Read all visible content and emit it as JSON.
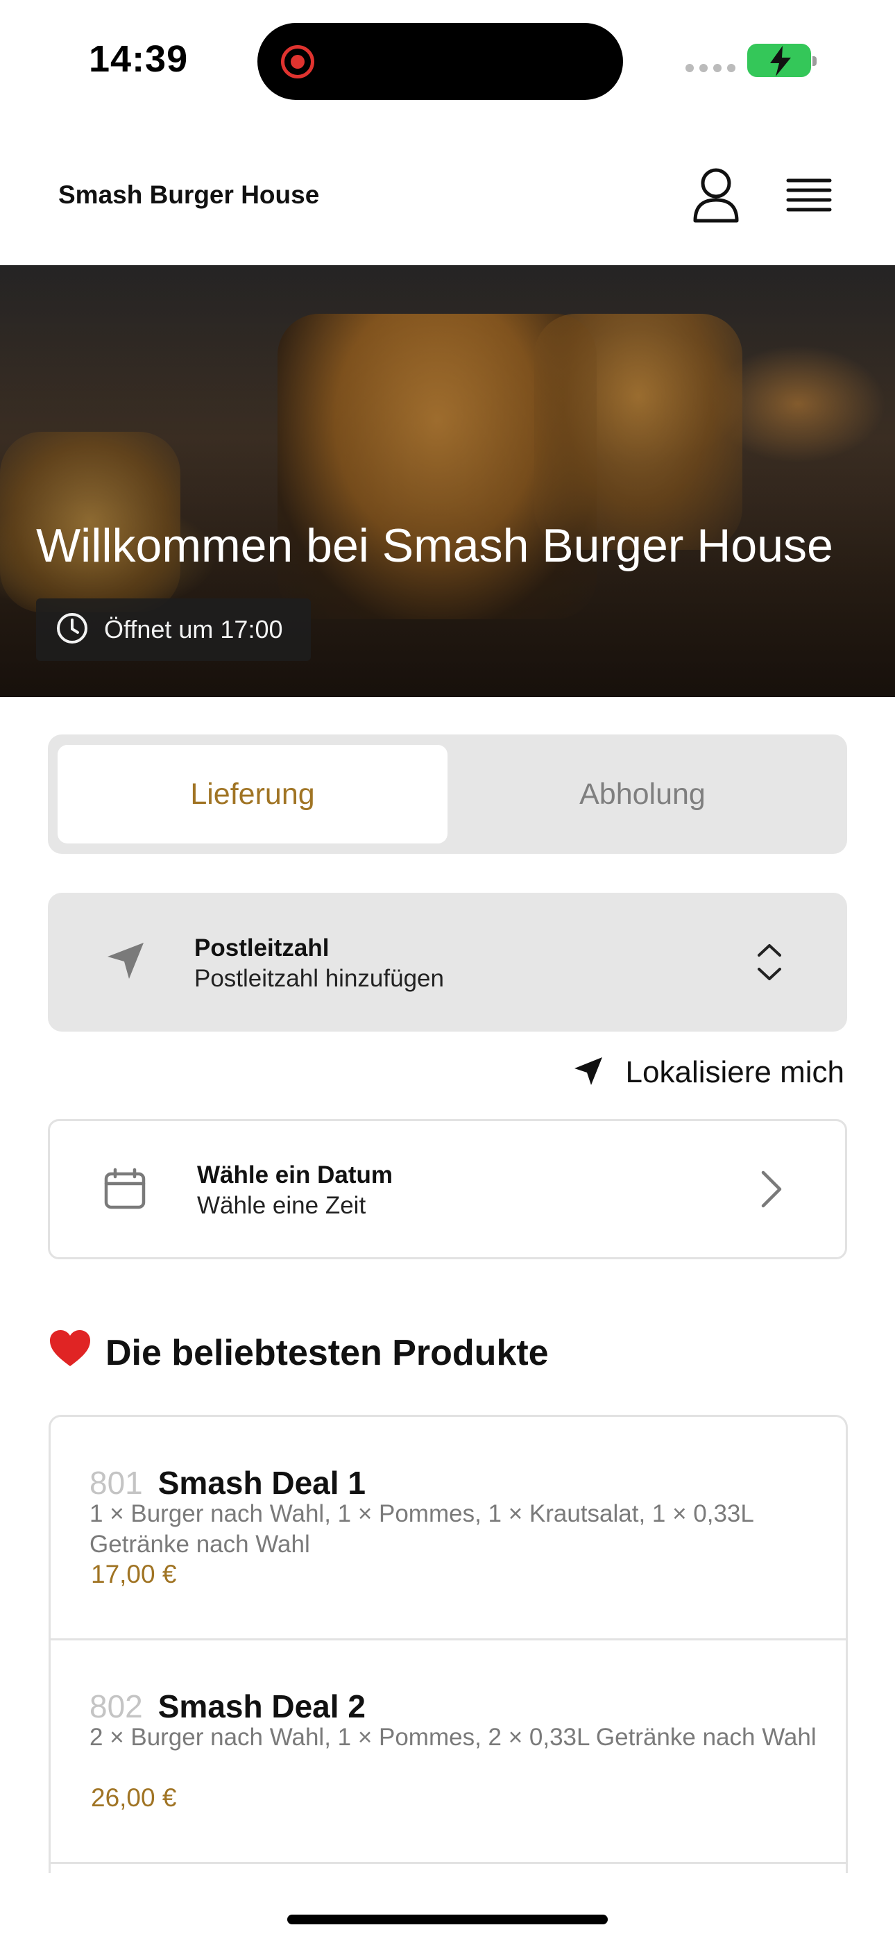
{
  "status_bar": {
    "time": "14:39",
    "battery_color": "#34c759",
    "record_color": "#e0332f"
  },
  "header": {
    "brand": "Smash Burger House",
    "icons": [
      "user-icon",
      "menu-icon"
    ]
  },
  "hero": {
    "title": "Willkommen bei Smash Burger House",
    "hours": "Öffnet um 17:00"
  },
  "order_mode": {
    "options": [
      {
        "label": "Lieferung",
        "active": true
      },
      {
        "label": "Abholung",
        "active": false
      }
    ],
    "accent_color": "#a07424"
  },
  "postal": {
    "label": "Postleitzahl",
    "value": "Postleitzahl hinzufügen"
  },
  "locate": {
    "label": "Lokalisiere mich"
  },
  "schedule": {
    "label": "Wähle ein Datum",
    "value": "Wähle eine Zeit"
  },
  "popular": {
    "emoji": "❤️",
    "title": "Die beliebtesten Produkte",
    "items": [
      {
        "number": "801",
        "name": "Smash Deal 1",
        "description": "1 × Burger nach Wahl, 1 × Pommes, 1 × Krautsalat, 1 × 0,33L Getränke nach Wahl",
        "price": "17,00 €"
      },
      {
        "number": "802",
        "name": "Smash Deal 2",
        "description": "2 × Burger nach Wahl, 1 × Pommes, 2 × 0,33L Getränke nach Wahl",
        "price": "26,00 €"
      }
    ]
  }
}
